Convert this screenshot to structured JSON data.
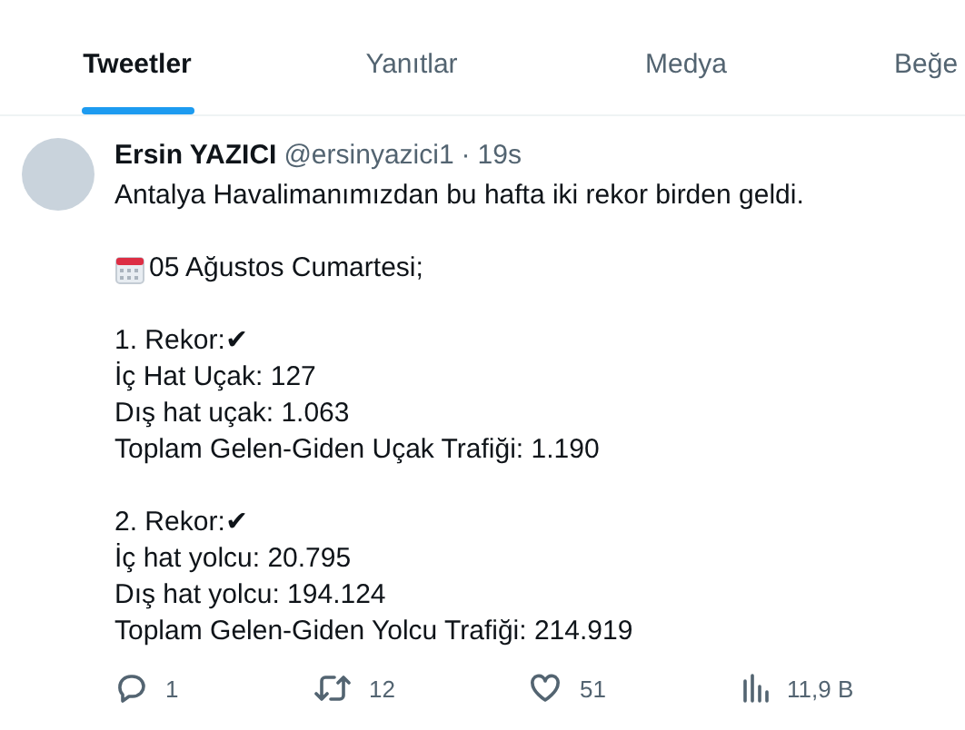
{
  "tabs": [
    {
      "label": "Tweetler",
      "selected": true
    },
    {
      "label": "Yanıtlar",
      "selected": false
    },
    {
      "label": "Medya",
      "selected": false
    },
    {
      "label": "Beğe",
      "selected": false
    }
  ],
  "tweet": {
    "name": "Ersin YAZICI",
    "handle": "@ersinyazici1",
    "separator": "·",
    "time": "19s",
    "paragraphs": [
      {
        "kind": "plain",
        "lines": [
          "Antalya Havalimanımızdan bu hafta iki rekor birden geldi."
        ]
      },
      {
        "kind": "dated",
        "lines": [
          "05 Ağustos Cumartesi;"
        ]
      },
      {
        "kind": "plain",
        "lines": [
          "1. Rekor:✔",
          "İç Hat Uçak: 127",
          "Dış hat uçak: 1.063",
          "Toplam Gelen-Giden Uçak Trafiği: 1.190"
        ]
      },
      {
        "kind": "plain",
        "lines": [
          "2. Rekor:✔",
          "İç hat yolcu: 20.795",
          "Dış hat yolcu: 194.124",
          "Toplam Gelen-Giden Yolcu Trafiği: 214.919"
        ]
      }
    ],
    "actions": [
      {
        "kind": "reply",
        "count": "1"
      },
      {
        "kind": "retweet",
        "count": "12"
      },
      {
        "kind": "like",
        "count": "51"
      },
      {
        "kind": "views",
        "count": "11,9 B"
      }
    ]
  }
}
